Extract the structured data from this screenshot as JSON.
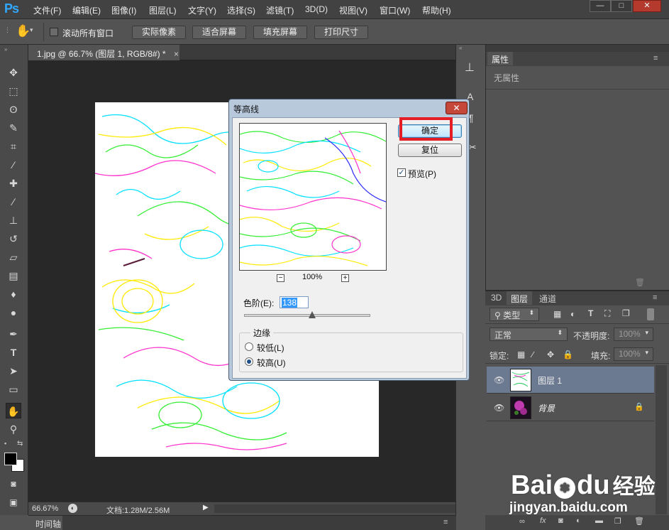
{
  "app": {
    "logo": "Ps"
  },
  "menu": [
    "文件(F)",
    "编辑(E)",
    "图像(I)",
    "图层(L)",
    "文字(Y)",
    "选择(S)",
    "滤镜(T)",
    "3D(D)",
    "视图(V)",
    "窗口(W)",
    "帮助(H)"
  ],
  "window_buttons": {
    "minimize": "—",
    "restore": "□",
    "close": "✕"
  },
  "options": {
    "scroll_all_label": "滚动所有窗口",
    "actual_pixels": "实际像素",
    "fit_screen": "适合屏幕",
    "fill_screen": "填充屏幕",
    "print_size": "打印尺寸"
  },
  "document": {
    "tab_title": "1.jpg @ 66.7% (图层 1, RGB/8#) *",
    "tab_close": "×"
  },
  "status": {
    "zoom": "66.67%",
    "doc_size": "文档:1.28M/2.56M"
  },
  "timeline": {
    "label": "时间轴"
  },
  "dialog": {
    "title": "等高线",
    "close": "✕",
    "ok": "确定",
    "reset": "复位",
    "preview_label": "预览(P)",
    "preview_checked": true,
    "zoom_percent": "100%",
    "zoom_out": "−",
    "zoom_in": "+",
    "level_label": "色阶(E):",
    "level_value": "138",
    "level_fraction": 0.54,
    "edge_group_label": "边缘",
    "edge_lower": "较低(L)",
    "edge_upper": "较高(U)",
    "edge_selected": "upper"
  },
  "properties": {
    "tab": "属性",
    "empty_text": "无属性"
  },
  "layers_panel": {
    "tabs": [
      "3D",
      "图层",
      "通道"
    ],
    "active_tab": "图层",
    "filter_kind": "类型",
    "blend_mode": "正常",
    "opacity_label": "不透明度:",
    "opacity_value": "100%",
    "lock_label": "锁定:",
    "fill_label": "填充:",
    "fill_value": "100%",
    "layers": [
      {
        "name": "图层 1",
        "selected": true,
        "locked": false
      },
      {
        "name": "背景",
        "selected": false,
        "locked": true
      }
    ],
    "footer_icons": [
      "link-icon",
      "fx-icon",
      "mask-icon",
      "adjustment-icon",
      "group-icon",
      "new-layer-icon",
      "trash-icon"
    ]
  },
  "watermark": {
    "brand": "Bai",
    "brand2": "du",
    "brand_cn": "经验",
    "url": "jingyan.baidu.com"
  }
}
